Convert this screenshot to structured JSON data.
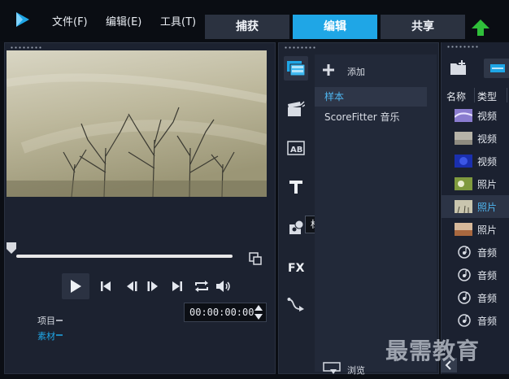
{
  "menu": {
    "file": "文件(F)",
    "edit": "编辑(E)",
    "tools": "工具(T)"
  },
  "tabs": [
    {
      "label": "捕获"
    },
    {
      "label": "编辑"
    },
    {
      "label": "共享"
    }
  ],
  "active_tab": "编辑",
  "player": {
    "mode_project": "项目",
    "mode_clip": "素材",
    "timecode": "00:00:00:00",
    "progress": 0
  },
  "library": {
    "add_label": "添加",
    "browse_label": "浏览",
    "tooltip": "标题",
    "items": [
      {
        "label": "样本"
      },
      {
        "label": "ScoreFitter 音乐"
      }
    ],
    "selected_index": 0
  },
  "media": {
    "columns": {
      "name": "名称",
      "type": "类型"
    },
    "rows": [
      {
        "type": "视频",
        "thumb": "purple"
      },
      {
        "type": "视频",
        "thumb": "gray"
      },
      {
        "type": "视频",
        "thumb": "blue"
      },
      {
        "type": "照片",
        "thumb": "green"
      },
      {
        "type": "照片",
        "thumb": "sepia"
      },
      {
        "type": "照片",
        "thumb": "brown"
      },
      {
        "type": "音频",
        "thumb": "audio"
      },
      {
        "type": "音频",
        "thumb": "audio"
      },
      {
        "type": "音频",
        "thumb": "audio"
      },
      {
        "type": "音频",
        "thumb": "audio"
      }
    ],
    "selected_index": 4
  },
  "watermark": "最需教育",
  "colors": {
    "accent": "#1fa6e6",
    "panel": "#1c2230",
    "selection_text": "#4fb6f0"
  }
}
